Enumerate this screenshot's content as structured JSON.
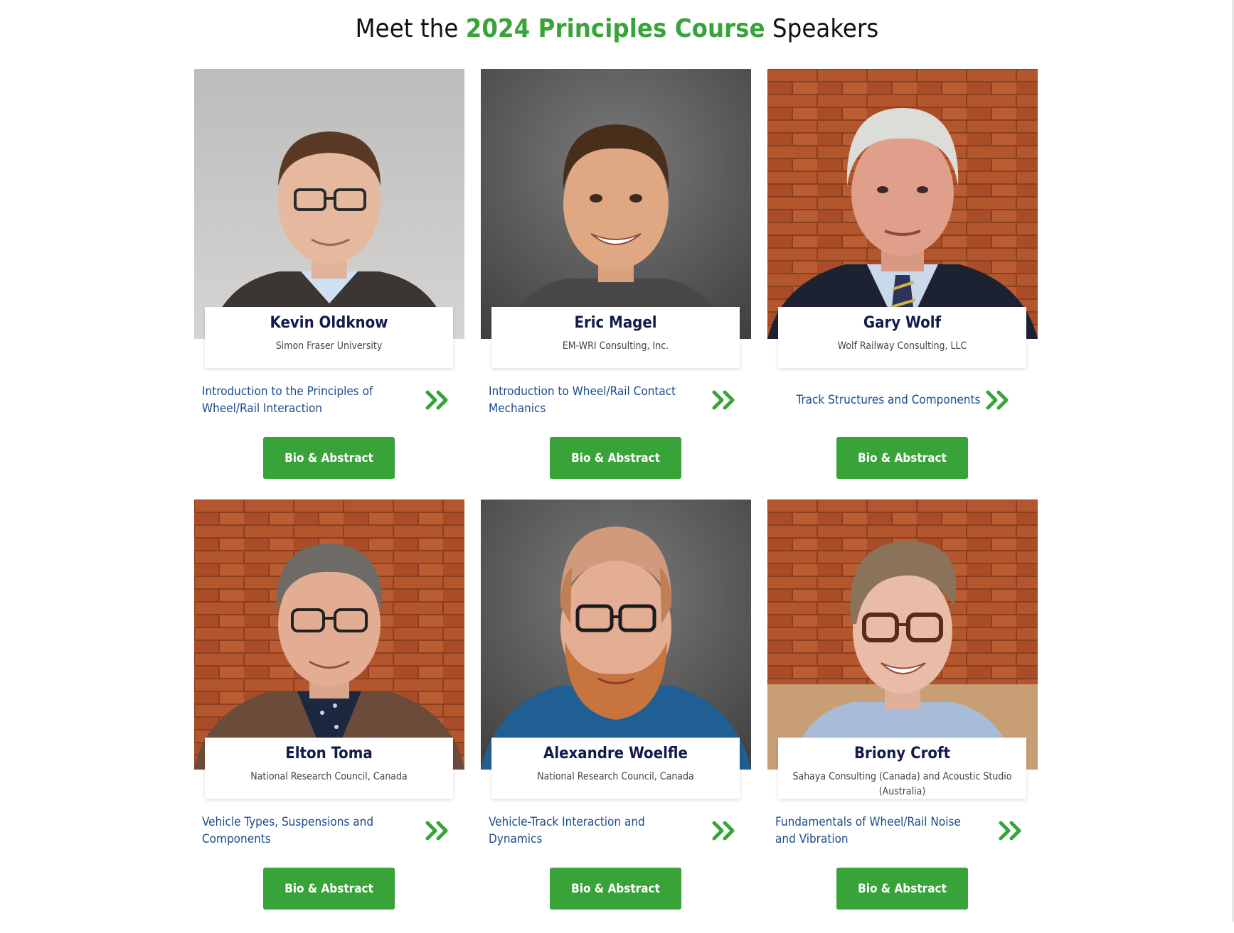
{
  "heading": {
    "prefix": "Meet the",
    "accent": "2024 Principles Course",
    "suffix": "Speakers",
    "accent_color": "#37a339"
  },
  "button_label": "Bio & Abstract",
  "speakers": [
    {
      "name": "Kevin Oldknow",
      "org": "Simon Fraser University",
      "topic": "Introduction to the Principles of Wheel/Rail Interaction",
      "photo_background": "light-grey"
    },
    {
      "name": "Eric Magel",
      "org": "EM-WRI Consulting, Inc.",
      "topic": "Introduction to Wheel/Rail Contact Mechanics",
      "photo_background": "dark-grey"
    },
    {
      "name": "Gary Wolf",
      "org": "Wolf Railway Consulting, LLC",
      "topic": "Track Structures and Components",
      "photo_background": "brick"
    },
    {
      "name": "Elton Toma",
      "org": "National Research Council, Canada",
      "topic": "Vehicle Types, Suspensions and Components",
      "photo_background": "brick"
    },
    {
      "name": "Alexandre Woelfle",
      "org": "National Research Council, Canada",
      "topic": "Vehicle-Track Interaction and Dynamics",
      "photo_background": "dark-grey"
    },
    {
      "name": "Briony Croft",
      "org": "Sahaya Consulting (Canada) and Acoustic Studio (Australia)",
      "topic": "Fundamentals of Wheel/Rail Noise and Vibration",
      "photo_background": "brick"
    }
  ],
  "icons": {
    "topic_link": "double-chevron-right-icon"
  }
}
